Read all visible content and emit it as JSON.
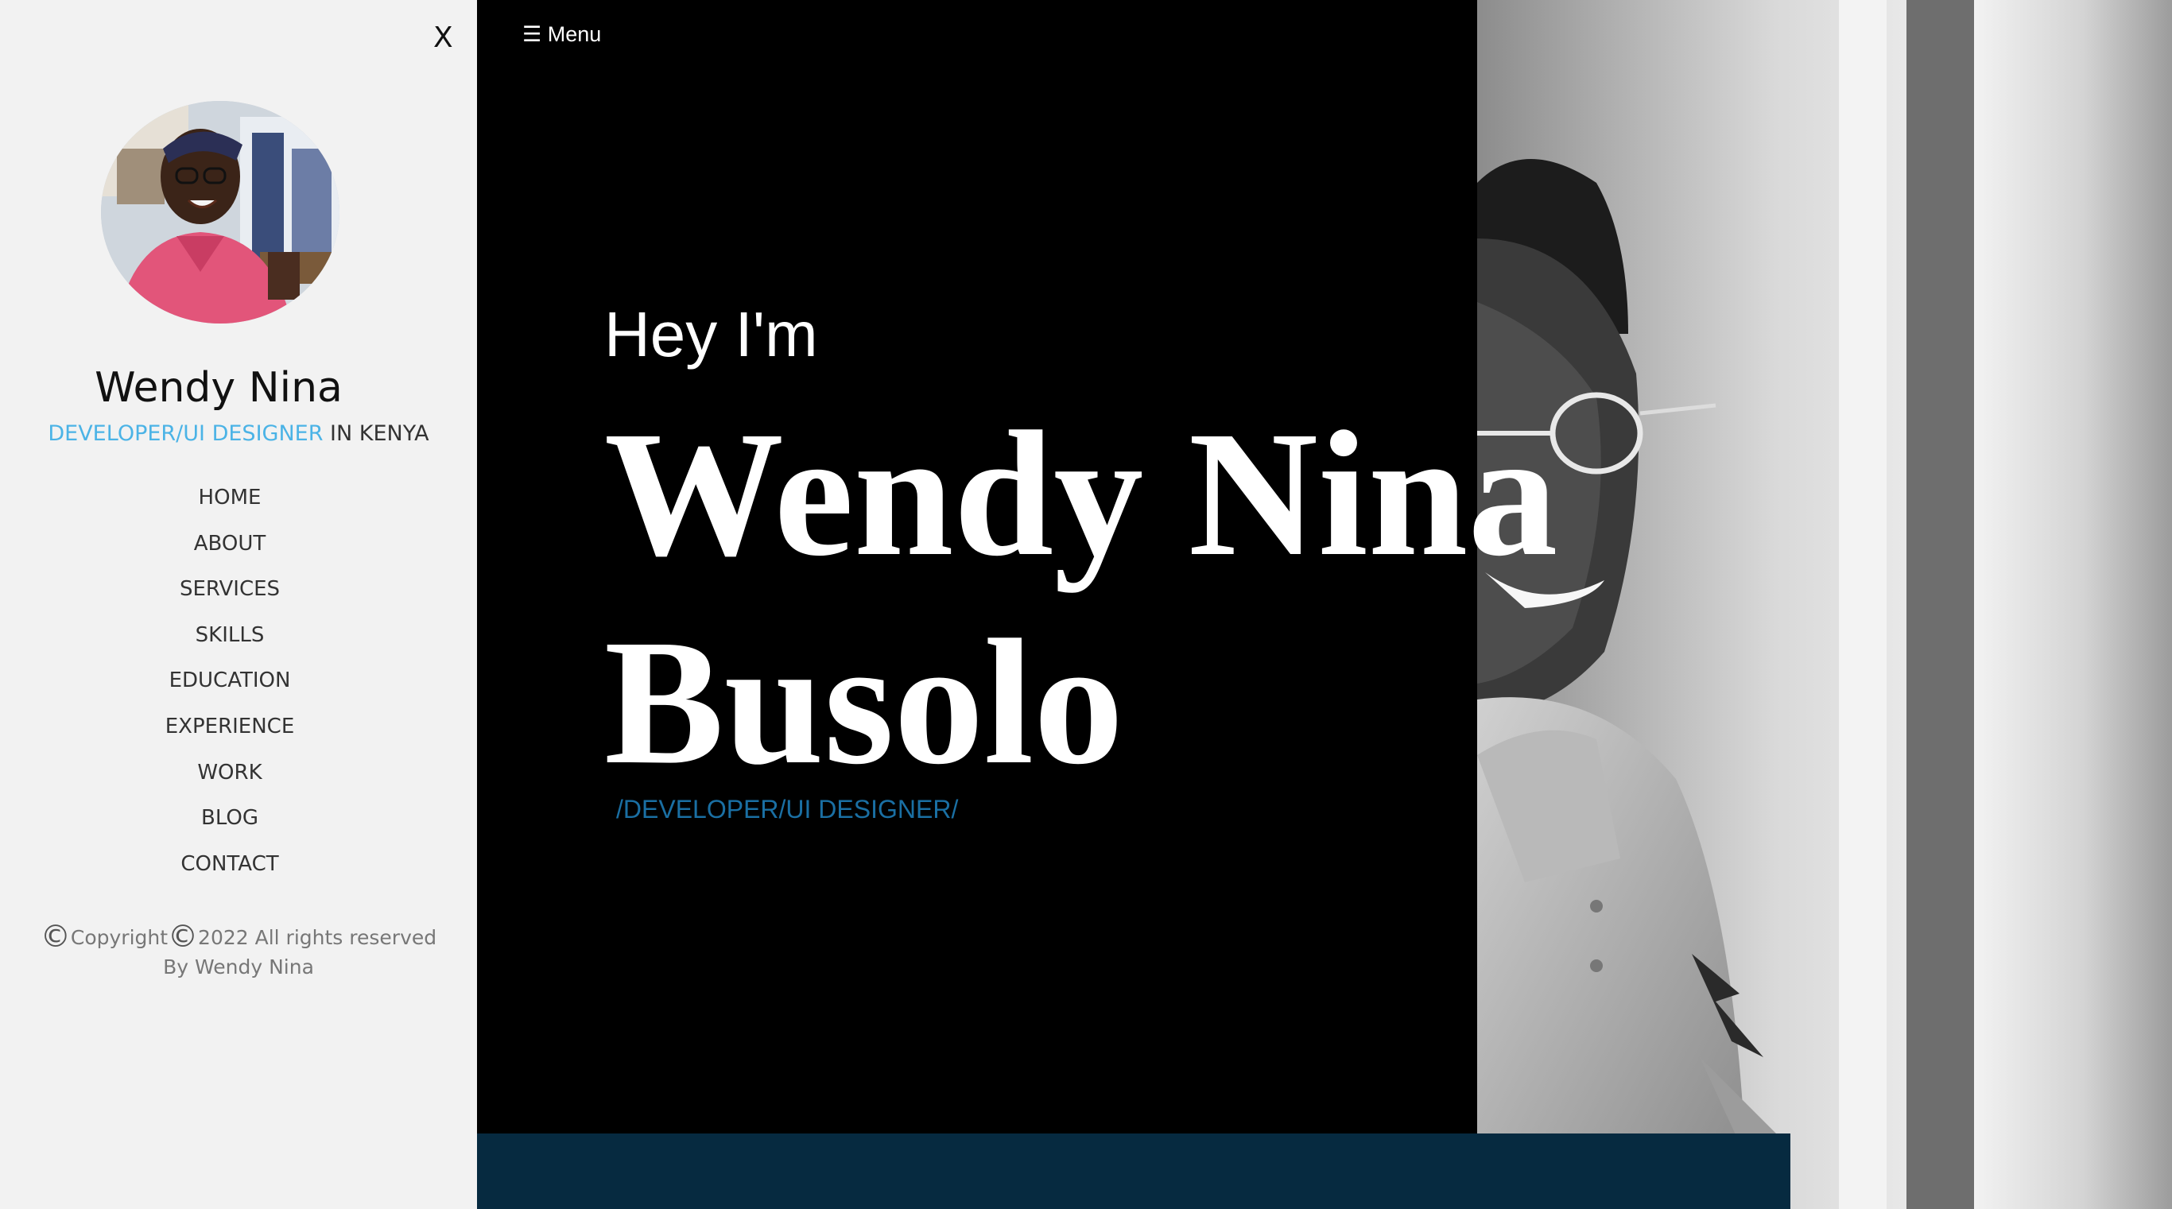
{
  "sidebar": {
    "close_label": "X",
    "avatar_icon": "profile-photo",
    "name": "Wendy Nina",
    "role_accent": "DEVELOPER/UI DESIGNER",
    "role_rest": " IN KENYA",
    "nav": [
      {
        "label": "HOME"
      },
      {
        "label": "ABOUT"
      },
      {
        "label": "SERVICES"
      },
      {
        "label": "SKILLS"
      },
      {
        "label": "EDUCATION"
      },
      {
        "label": "EXPERIENCE"
      },
      {
        "label": "WORK"
      },
      {
        "label": "BLOG"
      },
      {
        "label": "CONTACT"
      }
    ],
    "copyright_symbol": "©",
    "copyright_word": "Copyright",
    "copyright_year": "2022 All rights reserved",
    "copyright_by": "By Wendy Nina"
  },
  "hero": {
    "menu_label": "☰ Menu",
    "greeting": "Hey I'm",
    "name_line1": "Wendy Nina",
    "name_line2": "Busolo",
    "role": "/DEVELOPER/UI DESIGNER/"
  },
  "colors": {
    "accent": "#4bb3e6",
    "role_blue": "#1a6fa3",
    "hero_bg": "#000000",
    "footer_strip": "#062a40",
    "sidebar_bg": "#f2f2f2"
  }
}
